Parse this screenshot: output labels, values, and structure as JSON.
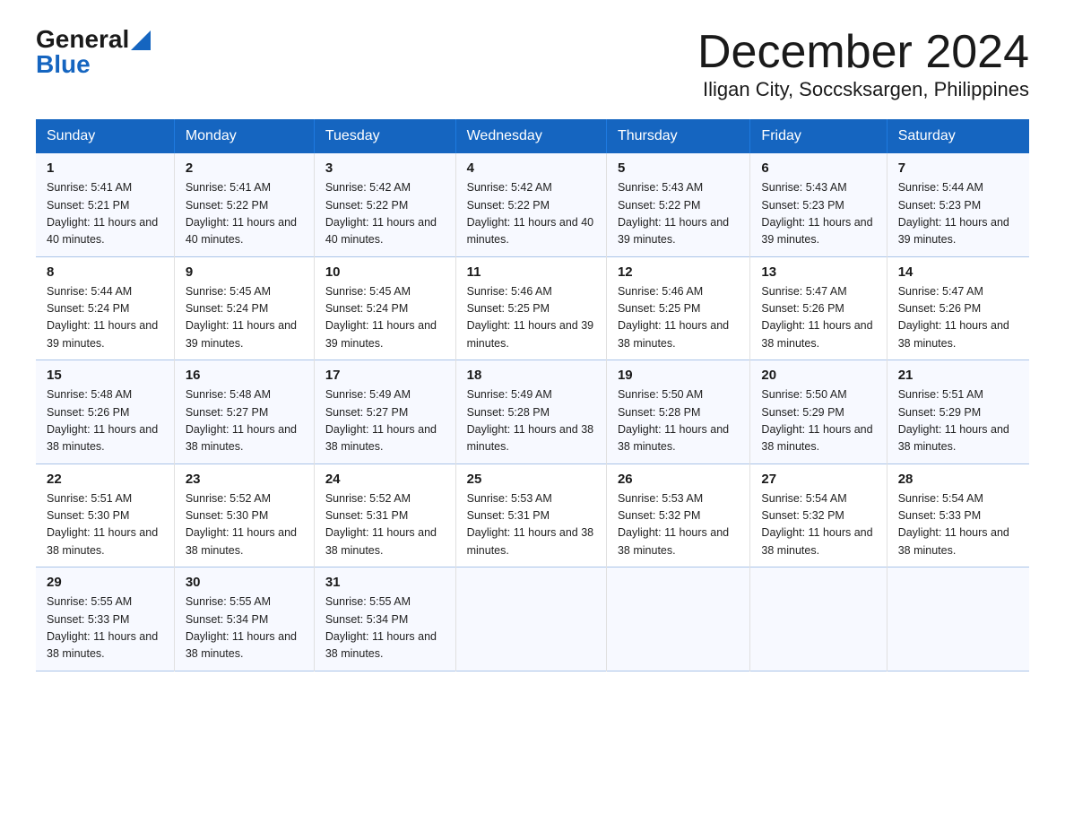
{
  "header": {
    "logo_line1": "General",
    "logo_line2": "Blue",
    "title": "December 2024",
    "subtitle": "Iligan City, Soccsksargen, Philippines"
  },
  "days_of_week": [
    "Sunday",
    "Monday",
    "Tuesday",
    "Wednesday",
    "Thursday",
    "Friday",
    "Saturday"
  ],
  "weeks": [
    [
      {
        "num": "1",
        "sunrise": "5:41 AM",
        "sunset": "5:21 PM",
        "daylight": "11 hours and 40 minutes."
      },
      {
        "num": "2",
        "sunrise": "5:41 AM",
        "sunset": "5:22 PM",
        "daylight": "11 hours and 40 minutes."
      },
      {
        "num": "3",
        "sunrise": "5:42 AM",
        "sunset": "5:22 PM",
        "daylight": "11 hours and 40 minutes."
      },
      {
        "num": "4",
        "sunrise": "5:42 AM",
        "sunset": "5:22 PM",
        "daylight": "11 hours and 40 minutes."
      },
      {
        "num": "5",
        "sunrise": "5:43 AM",
        "sunset": "5:22 PM",
        "daylight": "11 hours and 39 minutes."
      },
      {
        "num": "6",
        "sunrise": "5:43 AM",
        "sunset": "5:23 PM",
        "daylight": "11 hours and 39 minutes."
      },
      {
        "num": "7",
        "sunrise": "5:44 AM",
        "sunset": "5:23 PM",
        "daylight": "11 hours and 39 minutes."
      }
    ],
    [
      {
        "num": "8",
        "sunrise": "5:44 AM",
        "sunset": "5:24 PM",
        "daylight": "11 hours and 39 minutes."
      },
      {
        "num": "9",
        "sunrise": "5:45 AM",
        "sunset": "5:24 PM",
        "daylight": "11 hours and 39 minutes."
      },
      {
        "num": "10",
        "sunrise": "5:45 AM",
        "sunset": "5:24 PM",
        "daylight": "11 hours and 39 minutes."
      },
      {
        "num": "11",
        "sunrise": "5:46 AM",
        "sunset": "5:25 PM",
        "daylight": "11 hours and 39 minutes."
      },
      {
        "num": "12",
        "sunrise": "5:46 AM",
        "sunset": "5:25 PM",
        "daylight": "11 hours and 38 minutes."
      },
      {
        "num": "13",
        "sunrise": "5:47 AM",
        "sunset": "5:26 PM",
        "daylight": "11 hours and 38 minutes."
      },
      {
        "num": "14",
        "sunrise": "5:47 AM",
        "sunset": "5:26 PM",
        "daylight": "11 hours and 38 minutes."
      }
    ],
    [
      {
        "num": "15",
        "sunrise": "5:48 AM",
        "sunset": "5:26 PM",
        "daylight": "11 hours and 38 minutes."
      },
      {
        "num": "16",
        "sunrise": "5:48 AM",
        "sunset": "5:27 PM",
        "daylight": "11 hours and 38 minutes."
      },
      {
        "num": "17",
        "sunrise": "5:49 AM",
        "sunset": "5:27 PM",
        "daylight": "11 hours and 38 minutes."
      },
      {
        "num": "18",
        "sunrise": "5:49 AM",
        "sunset": "5:28 PM",
        "daylight": "11 hours and 38 minutes."
      },
      {
        "num": "19",
        "sunrise": "5:50 AM",
        "sunset": "5:28 PM",
        "daylight": "11 hours and 38 minutes."
      },
      {
        "num": "20",
        "sunrise": "5:50 AM",
        "sunset": "5:29 PM",
        "daylight": "11 hours and 38 minutes."
      },
      {
        "num": "21",
        "sunrise": "5:51 AM",
        "sunset": "5:29 PM",
        "daylight": "11 hours and 38 minutes."
      }
    ],
    [
      {
        "num": "22",
        "sunrise": "5:51 AM",
        "sunset": "5:30 PM",
        "daylight": "11 hours and 38 minutes."
      },
      {
        "num": "23",
        "sunrise": "5:52 AM",
        "sunset": "5:30 PM",
        "daylight": "11 hours and 38 minutes."
      },
      {
        "num": "24",
        "sunrise": "5:52 AM",
        "sunset": "5:31 PM",
        "daylight": "11 hours and 38 minutes."
      },
      {
        "num": "25",
        "sunrise": "5:53 AM",
        "sunset": "5:31 PM",
        "daylight": "11 hours and 38 minutes."
      },
      {
        "num": "26",
        "sunrise": "5:53 AM",
        "sunset": "5:32 PM",
        "daylight": "11 hours and 38 minutes."
      },
      {
        "num": "27",
        "sunrise": "5:54 AM",
        "sunset": "5:32 PM",
        "daylight": "11 hours and 38 minutes."
      },
      {
        "num": "28",
        "sunrise": "5:54 AM",
        "sunset": "5:33 PM",
        "daylight": "11 hours and 38 minutes."
      }
    ],
    [
      {
        "num": "29",
        "sunrise": "5:55 AM",
        "sunset": "5:33 PM",
        "daylight": "11 hours and 38 minutes."
      },
      {
        "num": "30",
        "sunrise": "5:55 AM",
        "sunset": "5:34 PM",
        "daylight": "11 hours and 38 minutes."
      },
      {
        "num": "31",
        "sunrise": "5:55 AM",
        "sunset": "5:34 PM",
        "daylight": "11 hours and 38 minutes."
      },
      null,
      null,
      null,
      null
    ]
  ]
}
